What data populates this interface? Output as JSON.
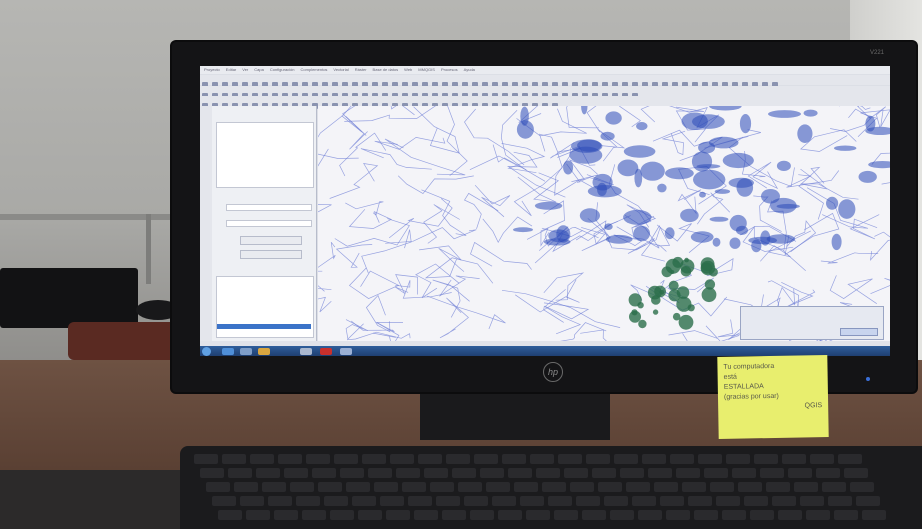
{
  "monitor": {
    "brand_logo": "hp",
    "model_label": "V221"
  },
  "app": {
    "menu": [
      "Proyecto",
      "Editar",
      "Ver",
      "Capa",
      "Configuración",
      "Complementos",
      "Vectorial",
      "Ráster",
      "Base de datos",
      "Web",
      "MMQGIS",
      "Procesos",
      "Ayuda"
    ]
  },
  "panel": {
    "title": "Capas",
    "btn_1": "Cargar el complemento",
    "btn_2": "Seleccionar capa"
  },
  "dialog": {
    "title": "Nueva versión de QGIS",
    "button": "Cerrar"
  },
  "sticky_note": {
    "lines": [
      "Tu computadora",
      "está",
      "ESTALLADA",
      "(gracias por usar)",
      "QGIS"
    ]
  },
  "colors": {
    "map_lines": "#6f7fd6",
    "map_fill": "#2c4bb8",
    "map_green": "#2b6e4a",
    "taskbar": "#2a518f"
  },
  "icons": [
    "hp-logo-icon",
    "start-orb-icon",
    "ie-icon",
    "folder-icon",
    "pdf-icon",
    "qgis-icon"
  ]
}
